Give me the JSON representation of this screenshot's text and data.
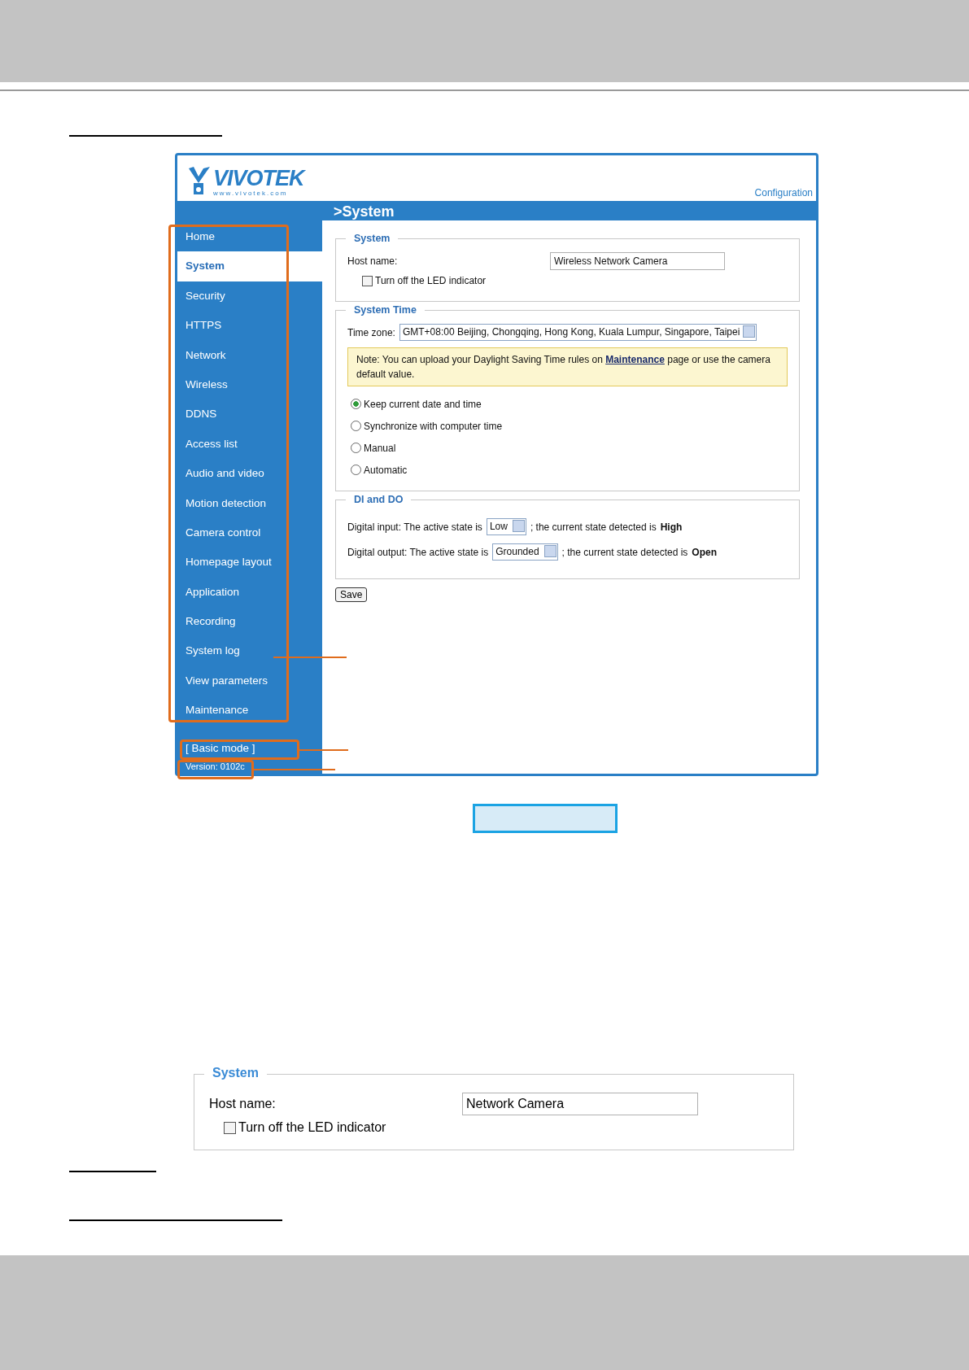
{
  "screenshot": {
    "logo": "VIVOTEK",
    "logo_url": "www.vivotek.com",
    "config_link": "Configuration",
    "page_title": ">System",
    "nav": [
      {
        "label": "Home",
        "selected": false
      },
      {
        "label": "System",
        "selected": true
      },
      {
        "label": "Security",
        "selected": false
      },
      {
        "label": "HTTPS",
        "selected": false
      },
      {
        "label": "Network",
        "selected": false
      },
      {
        "label": "Wireless",
        "selected": false
      },
      {
        "label": "DDNS",
        "selected": false
      },
      {
        "label": "Access list",
        "selected": false
      },
      {
        "label": "Audio and video",
        "selected": false
      },
      {
        "label": "Motion detection",
        "selected": false
      },
      {
        "label": "Camera control",
        "selected": false
      },
      {
        "label": "Homepage layout",
        "selected": false
      },
      {
        "label": "Application",
        "selected": false
      },
      {
        "label": "Recording",
        "selected": false
      },
      {
        "label": "System log",
        "selected": false
      },
      {
        "label": "View parameters",
        "selected": false
      },
      {
        "label": "Maintenance",
        "selected": false
      }
    ],
    "basic_mode": "[ Basic mode ]",
    "version": "Version: 0102c",
    "system": {
      "legend": "System",
      "host_label": "Host name:",
      "host_value": "Wireless Network Camera",
      "led_label": "Turn off the LED indicator",
      "led_checked": false
    },
    "system_time": {
      "legend": "System Time",
      "timezone_label": "Time zone:",
      "timezone_value": "GMT+08:00 Beijing, Chongqing, Hong Kong, Kuala Lumpur, Singapore, Taipei",
      "note_before": "Note: You can upload your Daylight Saving Time rules on",
      "note_link": "Maintenance",
      "note_after": "page or use the camera default value.",
      "radios": [
        {
          "label": "Keep current date and time",
          "selected": true
        },
        {
          "label": "Synchronize with computer time",
          "selected": false
        },
        {
          "label": "Manual",
          "selected": false
        },
        {
          "label": "Automatic",
          "selected": false
        }
      ]
    },
    "di_do": {
      "legend": "DI and DO",
      "rows": [
        {
          "prefix": "Digital input: The active state is",
          "value": "Low",
          "middle": "; the current state detected is",
          "state": "High"
        },
        {
          "prefix": "Digital output: The active state is",
          "value": "Grounded",
          "middle": "; the current state detected is",
          "state": "Open"
        }
      ]
    },
    "save": "Save"
  },
  "detail": {
    "legend": "System",
    "host_label": "Host name:",
    "host_value": "Network Camera",
    "led_label": "Turn off the LED indicator",
    "led_checked": false
  }
}
